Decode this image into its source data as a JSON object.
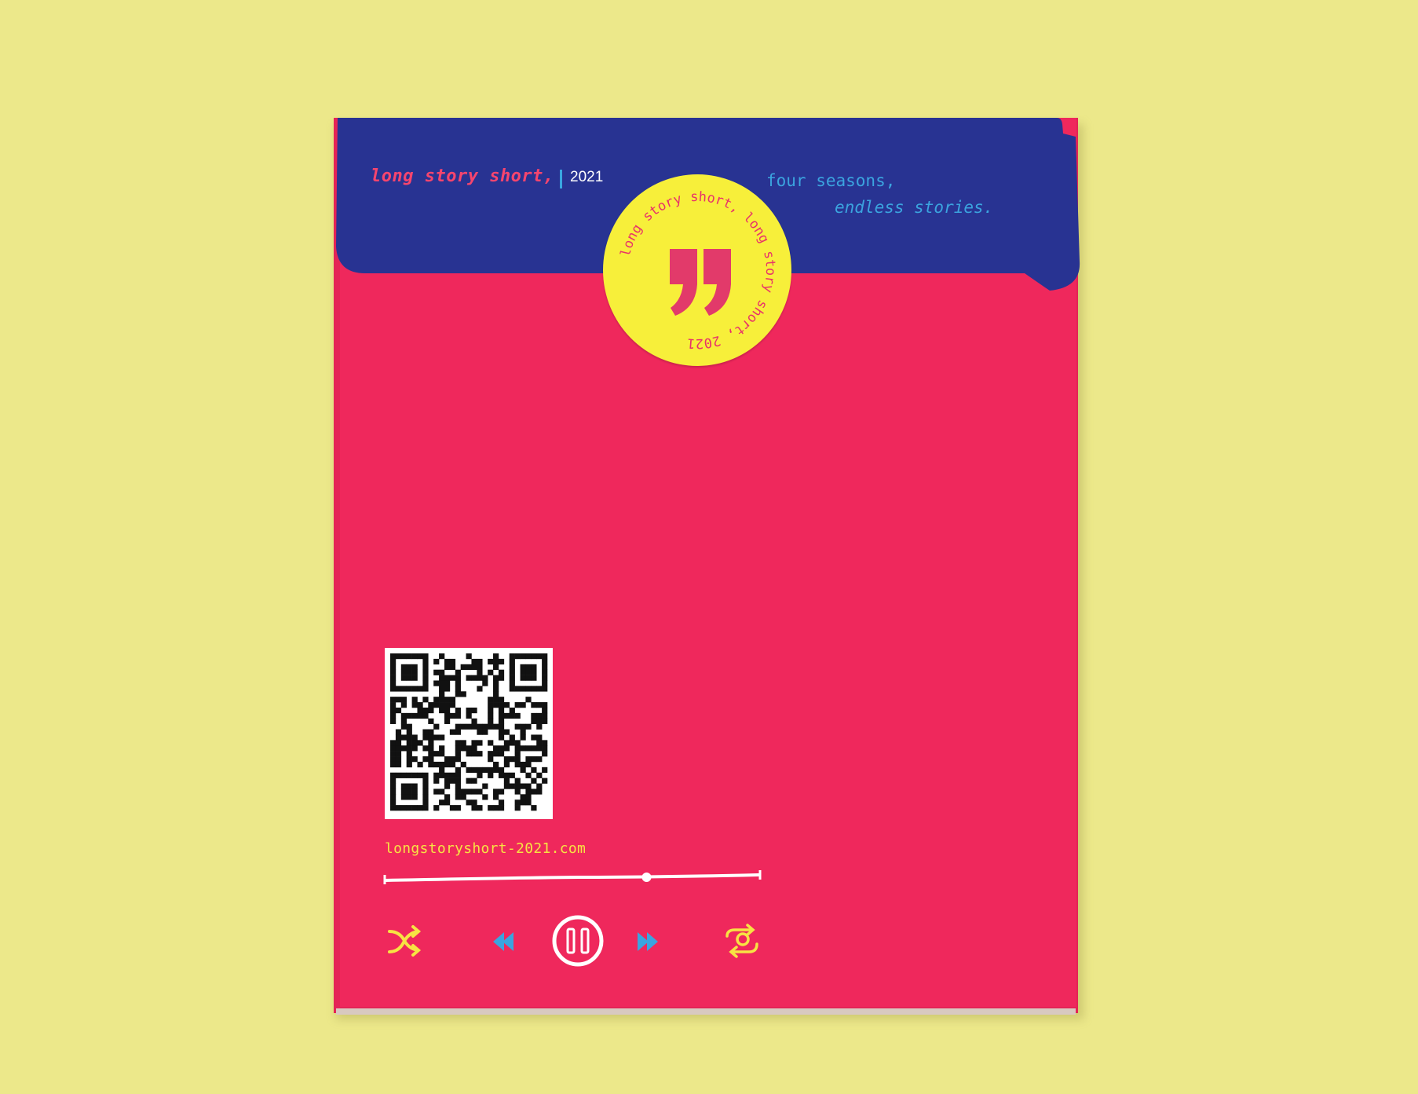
{
  "cover": {
    "brand_text": "long story short,",
    "year": "2021",
    "tagline_line1": "four seasons,",
    "tagline_line2": "endless stories.",
    "url": "longstoryshort-2021.com"
  },
  "sticker": {
    "ring_text": "long story short, long story short, 2021",
    "glyph": "quote-mark-icon"
  },
  "player": {
    "progress": 0.7,
    "icons": [
      "shuffle-icon",
      "rewind-icon",
      "pause-icon",
      "fast-forward-icon",
      "repeat-one-icon"
    ]
  },
  "colors": {
    "background": "#ece88a",
    "cover": "#ef285c",
    "flap": "#283392",
    "sticker": "#f7ef3a",
    "accent_blue": "#3ba4df",
    "accent_yellow": "#f7e343"
  }
}
